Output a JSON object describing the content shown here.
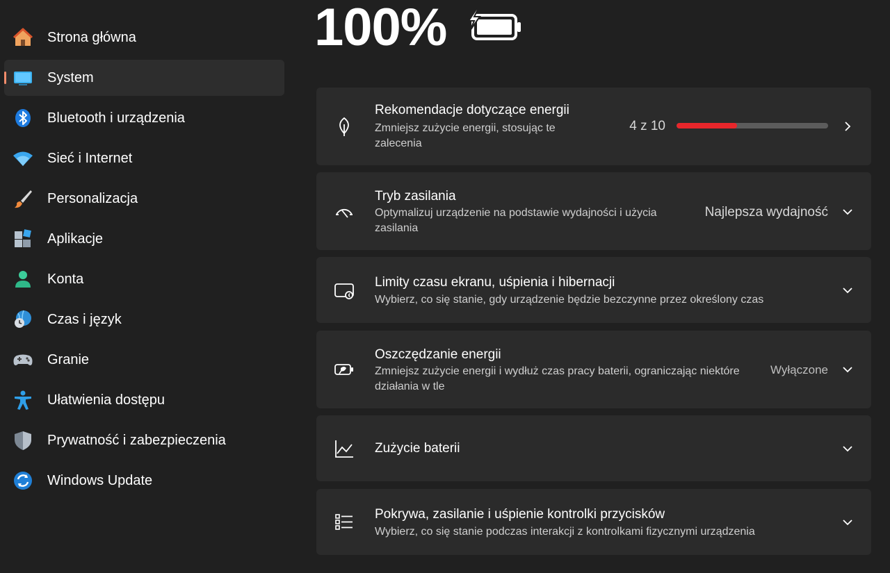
{
  "sidebar": {
    "items": [
      {
        "label": "Strona główna",
        "icon": "home-icon"
      },
      {
        "label": "System",
        "icon": "monitor-icon",
        "selected": true
      },
      {
        "label": "Bluetooth i urządzenia",
        "icon": "bluetooth-icon"
      },
      {
        "label": "Sieć i Internet",
        "icon": "wifi-icon"
      },
      {
        "label": "Personalizacja",
        "icon": "brush-icon"
      },
      {
        "label": "Aplikacje",
        "icon": "apps-icon"
      },
      {
        "label": "Konta",
        "icon": "person-icon"
      },
      {
        "label": "Czas i język",
        "icon": "globe-clock-icon"
      },
      {
        "label": "Granie",
        "icon": "gamepad-icon"
      },
      {
        "label": "Ułatwienia dostępu",
        "icon": "accessibility-icon"
      },
      {
        "label": "Prywatność i zabezpieczenia",
        "icon": "shield-icon"
      },
      {
        "label": "Windows Update",
        "icon": "update-icon"
      }
    ]
  },
  "battery": {
    "percent": "100%",
    "charging": true
  },
  "cards": {
    "energy_recommendations": {
      "title": "Rekomendacje dotyczące energii",
      "description": "Zmniejsz zużycie energii, stosując te zalecenia",
      "value": "4 z 10",
      "progress": 0.4,
      "icon": "leaf-icon"
    },
    "power_mode": {
      "title": "Tryb zasilania",
      "description": "Optymalizuj urządzenie na podstawie wydajności i użycia zasilania",
      "value": "Najlepsza wydajność",
      "icon": "gauge-icon"
    },
    "screen_sleep": {
      "title": "Limity czasu ekranu, uśpienia i hibernacji",
      "description": "Wybierz, co się stanie, gdy urządzenie będzie bezczynne przez określony czas",
      "icon": "screen-sleep-icon"
    },
    "energy_saver": {
      "title": "Oszczędzanie energii",
      "description": "Zmniejsz zużycie energii i wydłuż czas pracy baterii, ograniczając niektóre działania w tle",
      "value": "Wyłączone",
      "icon": "energy-saver-icon"
    },
    "battery_usage": {
      "title": "Zużycie baterii",
      "icon": "chart-icon"
    },
    "lid_buttons": {
      "title": "Pokrywa, zasilanie i uśpienie kontrolki przycisków",
      "description": "Wybierz, co się stanie podczas interakcji z kontrolkami fizycznymi urządzenia",
      "icon": "list-icon"
    }
  },
  "colors": {
    "accent": "#e8262b",
    "selection_indicator": "#f28c6b",
    "card_bg": "#2b2b2b",
    "page_bg": "#202020"
  }
}
